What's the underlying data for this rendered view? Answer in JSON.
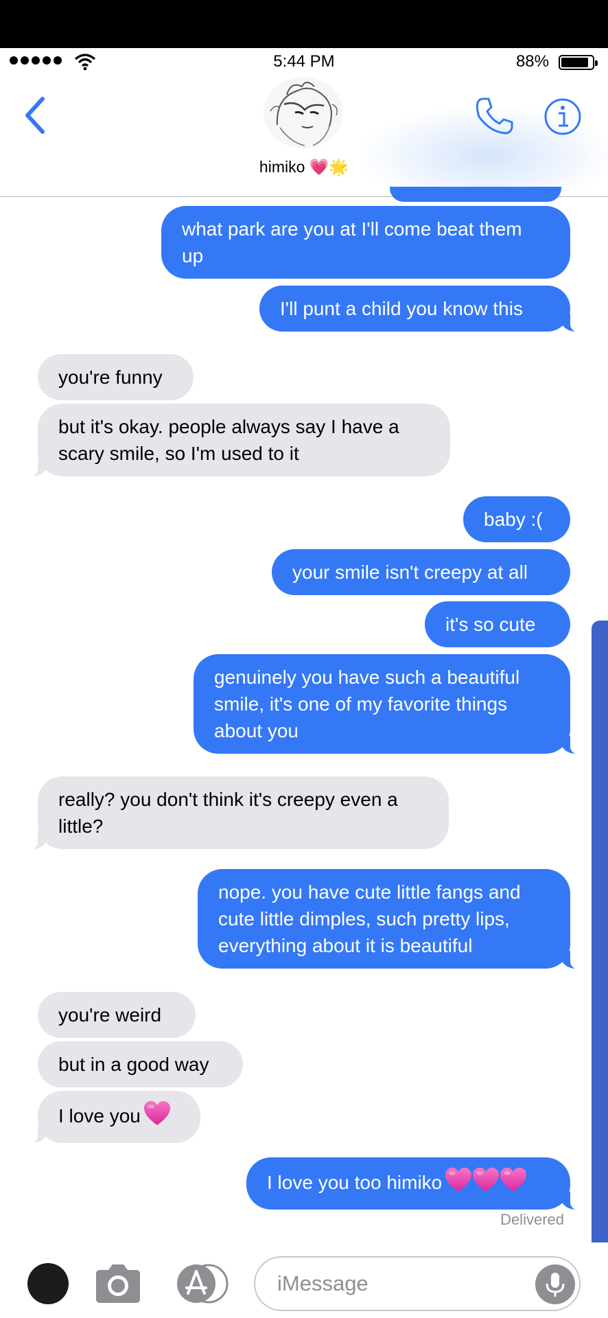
{
  "status_bar": {
    "time": "5:44 PM",
    "battery_percent": "88%",
    "battery_level": 0.88
  },
  "header": {
    "contact_name": "himiko",
    "name_emoji": "💗🌟"
  },
  "messages": [
    {
      "side": "out",
      "text": "what park are you at I'll come beat them\nup"
    },
    {
      "side": "out",
      "text": "I'll punt a child you know this"
    },
    {
      "side": "in",
      "text": "you're funny"
    },
    {
      "side": "in",
      "text": "but it's okay. people always say I have a\nscary smile, so I'm used to it"
    },
    {
      "side": "out",
      "text": "baby :("
    },
    {
      "side": "out",
      "text": "your smile isn't creepy at all"
    },
    {
      "side": "out",
      "text": "it's so cute"
    },
    {
      "side": "out",
      "text": "genuinely you have such a beautiful\nsmile, it's one of my favorite things\nabout you"
    },
    {
      "side": "in",
      "text": "really? you don't think it's creepy even a\nlittle?"
    },
    {
      "side": "out",
      "text": "nope. you have cute little fangs and\ncute little dimples, such pretty lips,\neverything about it is beautiful"
    },
    {
      "side": "in",
      "text": "you're weird"
    },
    {
      "side": "in",
      "text": "but in a good way"
    },
    {
      "side": "in",
      "text": "I love you",
      "hearts": 1
    },
    {
      "side": "out",
      "text": "I love you too himiko",
      "hearts": 3
    }
  ],
  "delivery_status": "Delivered",
  "composer": {
    "placeholder": "iMessage"
  },
  "colors": {
    "outgoing": "#3478f6",
    "incoming": "#e5e5ea",
    "accent": "#3478f6",
    "scrollbar": "#3d63c9"
  },
  "icons": [
    "back-chevron-icon",
    "phone-icon",
    "info-icon",
    "camera-icon",
    "app-store-icon",
    "microphone-icon"
  ]
}
